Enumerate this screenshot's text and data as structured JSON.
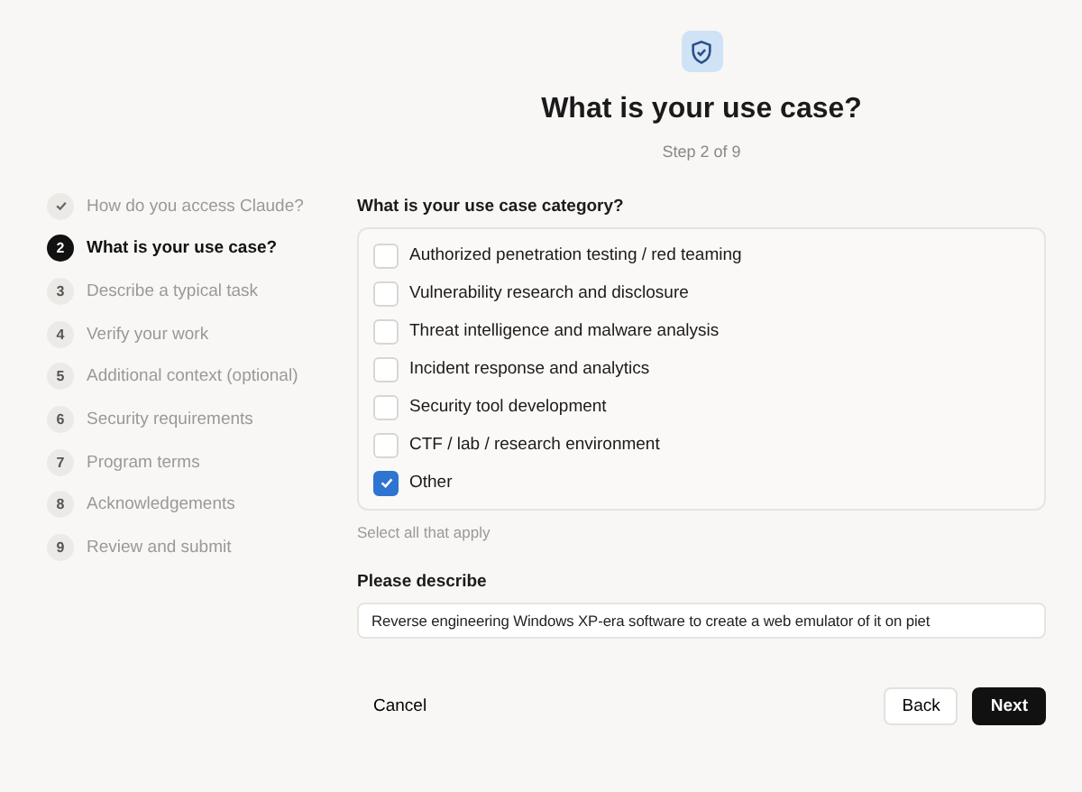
{
  "header": {
    "title": "What is your use case?",
    "step": "Step 2 of 9"
  },
  "steps": [
    {
      "label": "How do you access Claude?",
      "completed": true,
      "selected": false
    },
    {
      "number": "2",
      "label": "What is your use case?",
      "completed": false,
      "selected": true
    },
    {
      "number": "3",
      "label": "Describe a typical task",
      "completed": false,
      "selected": false
    },
    {
      "number": "4",
      "label": "Verify your work",
      "completed": false,
      "selected": false
    },
    {
      "number": "5",
      "label": "Additional context (optional)",
      "completed": false,
      "selected": false
    },
    {
      "number": "6",
      "label": "Security requirements",
      "completed": false,
      "selected": false
    },
    {
      "number": "7",
      "label": "Program terms",
      "completed": false,
      "selected": false
    },
    {
      "number": "8",
      "label": "Acknowledgements",
      "completed": false,
      "selected": false
    },
    {
      "number": "9",
      "label": "Review and submit",
      "completed": false,
      "selected": false
    }
  ],
  "category": {
    "question": "What is your use case category?",
    "hint": "Select all that apply",
    "options": [
      {
        "label": "Authorized penetration testing / red teaming",
        "checked": false
      },
      {
        "label": "Vulnerability research and disclosure",
        "checked": false
      },
      {
        "label": "Threat intelligence and malware analysis",
        "checked": false
      },
      {
        "label": "Incident response and analytics",
        "checked": false
      },
      {
        "label": "Security tool development",
        "checked": false
      },
      {
        "label": "CTF / lab / research environment",
        "checked": false
      },
      {
        "label": "Other",
        "checked": true
      }
    ]
  },
  "describe": {
    "label": "Please describe",
    "value": "Reverse engineering Windows XP-era software to create a web emulator of it on piet"
  },
  "buttons": {
    "cancel": "Cancel",
    "back": "Back",
    "next": "Next"
  }
}
